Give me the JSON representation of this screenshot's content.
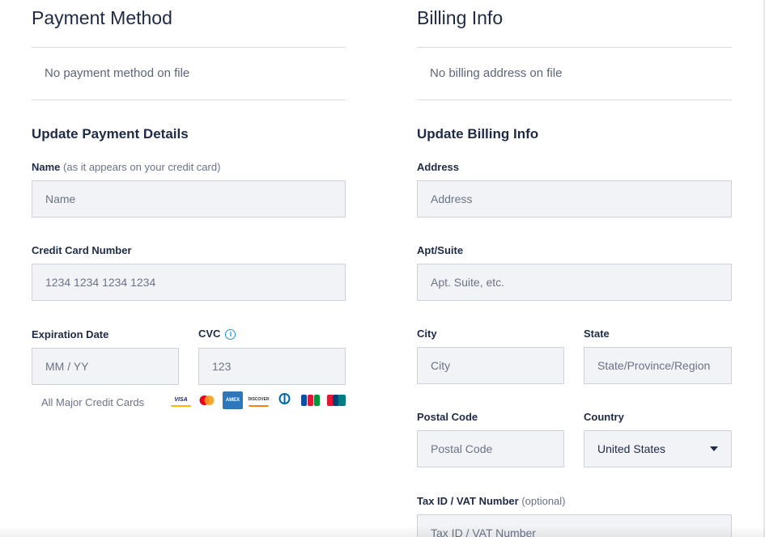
{
  "payment": {
    "title": "Payment Method",
    "empty_text": "No payment method on file",
    "update_title": "Update Payment Details",
    "name_label": "Name",
    "name_hint": "(as it appears on your credit card)",
    "name_placeholder": "Name",
    "card_label": "Credit Card Number",
    "card_placeholder": "1234 1234 1234 1234",
    "exp_label": "Expiration Date",
    "exp_placeholder": "MM / YY",
    "cvc_label": "CVC",
    "cvc_placeholder": "123",
    "cards_label": "All Major Credit Cards",
    "card_brands": [
      {
        "name": "VISA",
        "icon": "visa-card-icon",
        "bg": "#ffffff",
        "fg": "#1a1f71"
      },
      {
        "name": "",
        "icon": "mastercard-icon",
        "bg": "#ffffff",
        "fg": "#eb001b"
      },
      {
        "name": "AMEX",
        "icon": "amex-card-icon",
        "bg": "#2e77bc",
        "fg": "#ffffff"
      },
      {
        "name": "DISCOVER",
        "icon": "discover-card-icon",
        "bg": "#ffffff",
        "fg": "#f48120"
      },
      {
        "name": "DC",
        "icon": "diners-club-card-icon",
        "bg": "#ffffff",
        "fg": "#0069aa"
      },
      {
        "name": "JCB",
        "icon": "jcb-card-icon",
        "bg": "#ffffff",
        "fg": "#0b4ea2"
      },
      {
        "name": "UP",
        "icon": "unionpay-card-icon",
        "bg": "#e21836",
        "fg": "#ffffff"
      }
    ]
  },
  "billing": {
    "title": "Billing Info",
    "empty_text": "No billing address on file",
    "update_title": "Update Billing Info",
    "address_label": "Address",
    "address_placeholder": "Address",
    "apt_label": "Apt/Suite",
    "apt_placeholder": "Apt. Suite, etc.",
    "city_label": "City",
    "city_placeholder": "City",
    "state_label": "State",
    "state_placeholder": "State/Province/Region",
    "postal_label": "Postal Code",
    "postal_placeholder": "Postal Code",
    "country_label": "Country",
    "country_value": "United States",
    "tax_label": "Tax ID / VAT Number",
    "tax_hint": "(optional)",
    "tax_placeholder": "Tax ID / VAT Number"
  },
  "colors": {
    "text": "#1f2a44",
    "muted": "#6b7385",
    "input_bg": "#f1f3f6",
    "input_border": "#cdd3db",
    "accent": "#1a93d6"
  }
}
